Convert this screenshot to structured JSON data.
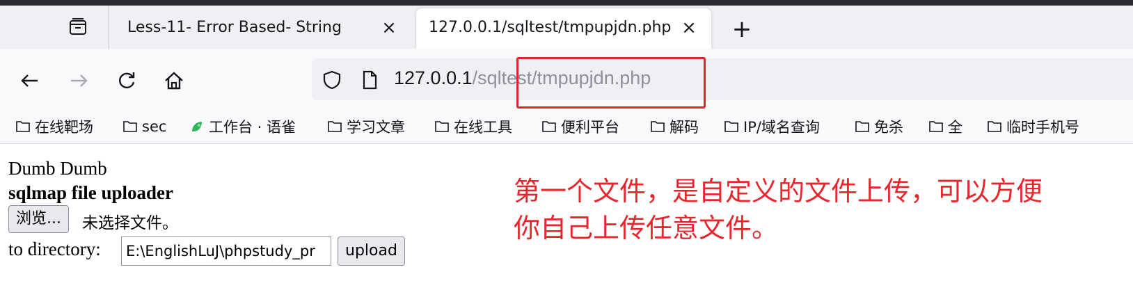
{
  "tabs": [
    {
      "title": "Less-11- Error Based- String",
      "active": false
    },
    {
      "title": "127.0.0.1/sqltest/tmpupjdn.php",
      "active": true
    }
  ],
  "icons": {
    "tab_list": "tab-list-icon",
    "close": "×",
    "new_tab": "+",
    "back": "←",
    "forward": "→",
    "reload": "reload-icon",
    "home": "home-icon",
    "shield": "shield-icon",
    "page": "page-icon",
    "folder": "folder-icon",
    "yuque": "yuque-leaf-icon"
  },
  "url": {
    "host": "127.0.0.1",
    "path": "/sqltest/tmpupjdn.php"
  },
  "bookmarks": [
    {
      "label": "在线靶场",
      "icon": "folder"
    },
    {
      "label": "sec",
      "icon": "folder"
    },
    {
      "label": "工作台 · 语雀",
      "icon": "yuque"
    },
    {
      "label": "学习文章",
      "icon": "folder"
    },
    {
      "label": "在线工具",
      "icon": "folder"
    },
    {
      "label": "便利平台",
      "icon": "folder"
    },
    {
      "label": "解码",
      "icon": "folder"
    },
    {
      "label": "IP/域名查询",
      "icon": "folder"
    },
    {
      "label": "免杀",
      "icon": "folder"
    },
    {
      "label": "全",
      "icon": "folder"
    },
    {
      "label": "临时手机号",
      "icon": "folder"
    }
  ],
  "page": {
    "line1": "Dumb Dumb",
    "heading": "sqlmap file uploader",
    "browse_label": "浏览...",
    "no_file": "未选择文件。",
    "to_directory_label": "to directory:",
    "directory_value": "E:\\EnglishLuJ\\phpstudy_pr",
    "upload_label": "upload"
  },
  "annotation": {
    "line1": "第一个文件，是自定义的文件上传，可以方便",
    "line2": "你自己上传任意文件。",
    "color": "#e8262d"
  },
  "colors": {
    "highlight_box": "#e0242b",
    "tabbar_bg": "#f0f0f4",
    "toolbar_bg": "#f9f9fb"
  }
}
